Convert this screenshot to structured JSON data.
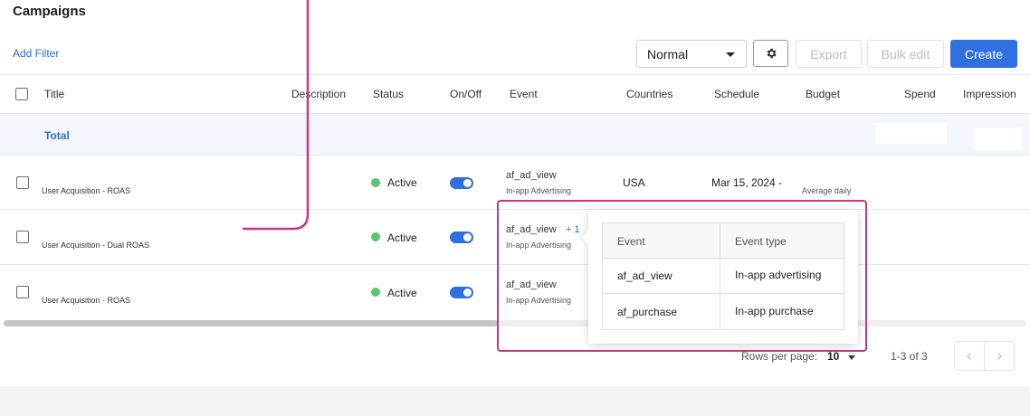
{
  "page": {
    "title": "Campaigns"
  },
  "toolbar": {
    "add_filter": "Add Filter",
    "view_mode": "Normal",
    "settings_icon": "gear-icon",
    "export_label": "Export",
    "bulk_edit_label": "Bulk edit",
    "create_label": "Create"
  },
  "colors": {
    "accent": "#2f6fe0",
    "status_active": "#55c96e",
    "highlight": "#c9367f"
  },
  "table": {
    "columns": [
      "Title",
      "Description",
      "Status",
      "On/Off",
      "Event",
      "Countries",
      "Schedule",
      "Budget",
      "Spend",
      "Impression"
    ],
    "total_label": "Total",
    "rows": [
      {
        "title": "User Acquisition - ROAS",
        "status": "Active",
        "on": true,
        "event": "af_ad_view",
        "event_more": "",
        "event_type": "In-app Advertising",
        "country": "USA",
        "schedule": "Mar 15, 2024 -",
        "budget": "Average daily"
      },
      {
        "title": "User Acquisition - Dual ROAS",
        "status": "Active",
        "on": true,
        "event": "af_ad_view",
        "event_more": "+ 1",
        "event_type": "In-app Advertising"
      },
      {
        "title": "User Acquisition - ROAS",
        "status": "Active",
        "on": true,
        "event": "af_ad_view",
        "event_type": "In-app Advertising"
      }
    ]
  },
  "events_popover": {
    "headers": [
      "Event",
      "Event type"
    ],
    "rows": [
      [
        "af_ad_view",
        "In-app advertising"
      ],
      [
        "af_purchase",
        "In-app purchase"
      ]
    ]
  },
  "pagination": {
    "rows_per_page_label": "Rows per page:",
    "rows_per_page": "10",
    "range": "1-3 of 3",
    "prev_icon": "chevron-left-icon",
    "next_icon": "chevron-right-icon"
  }
}
